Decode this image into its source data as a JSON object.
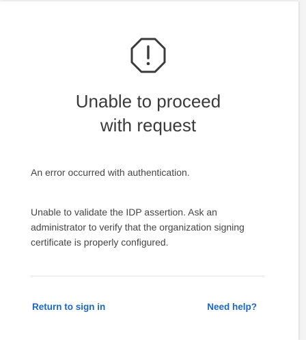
{
  "error": {
    "icon": "octagon-exclamation-icon",
    "title_line1": "Unable to proceed",
    "title_line2": "with request",
    "summary": "An error occurred with authentication.",
    "detail": "Unable to validate the IDP assertion. Ask an administrator to verify that the organization signing certificate is properly configured."
  },
  "actions": {
    "return_label": "Return to sign in",
    "help_label": "Need help?"
  },
  "colors": {
    "link": "#1a66c9",
    "text": "#3c3c3c",
    "icon": "#3a3a3a"
  }
}
